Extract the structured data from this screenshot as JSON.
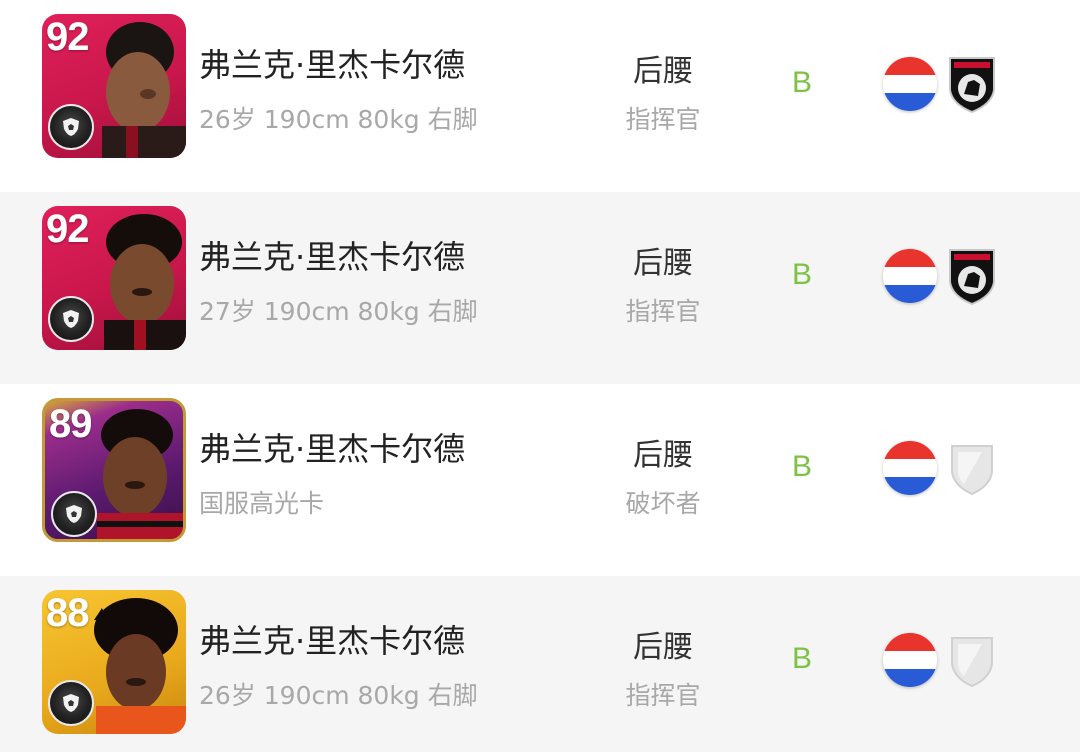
{
  "colors": {
    "grade": "#7cc243",
    "card_red": "#d01a4f",
    "card_gold": "#f0b324",
    "card_purple_border": "#c49a36",
    "flag_red": "#e8342c",
    "flag_white": "#ffffff",
    "flag_blue": "#2a5bd7"
  },
  "players": [
    {
      "rating": "92",
      "card_style": "red",
      "name": "弗兰克·里杰卡尔德",
      "info": "26岁 190cm 80kg 右脚",
      "position": "后腰",
      "playstyle": "指挥官",
      "grade": "B",
      "nation_icon": "netherlands-flag-icon",
      "club_icon": "milano-rn-crest-icon"
    },
    {
      "rating": "92",
      "card_style": "red",
      "name": "弗兰克·里杰卡尔德",
      "info": "27岁 190cm 80kg 右脚",
      "position": "后腰",
      "playstyle": "指挥官",
      "grade": "B",
      "nation_icon": "netherlands-flag-icon",
      "club_icon": "milano-rn-crest-icon"
    },
    {
      "rating": "89",
      "card_style": "purple",
      "name": "弗兰克·里杰卡尔德",
      "info": "国服高光卡",
      "position": "后腰",
      "playstyle": "破坏者",
      "grade": "B",
      "nation_icon": "netherlands-flag-icon",
      "club_icon": "generic-shield-icon"
    },
    {
      "rating": "88",
      "card_style": "gold",
      "name": "弗兰克·里杰卡尔德",
      "info": "26岁 190cm 80kg 右脚",
      "position": "后腰",
      "playstyle": "指挥官",
      "grade": "B",
      "nation_icon": "netherlands-flag-icon",
      "club_icon": "generic-shield-icon"
    }
  ]
}
